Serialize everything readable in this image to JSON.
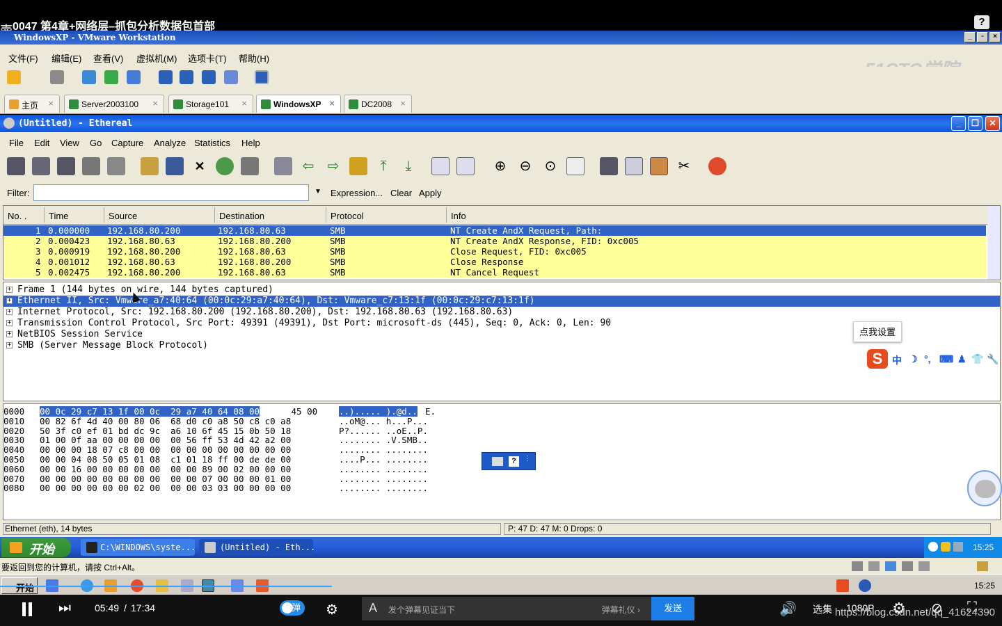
{
  "video": {
    "title": "0047 第4章+网络层–抓包分析数据包首部",
    "help_btn": "?",
    "corner_char": "壷",
    "time_current": "05:49",
    "time_sep": "/",
    "time_total": "17:34",
    "danmu_toggle": "弹",
    "danmu_placeholder": "发个弹幕见证当下",
    "danmu_gift": "弹幕礼仪 ›",
    "send": "发送",
    "select_episode": "选集",
    "quality": "1080P",
    "watermark": "https://blog.csdn.net/qq_41624390",
    "progress_fraction": 0.331
  },
  "vmware": {
    "title": "WindowsXP - VMware Workstation",
    "window_buttons": [
      "_",
      "▫",
      "×"
    ],
    "menu": [
      "文件(F)",
      "编辑(E)",
      "查看(V)",
      "虚拟机(M)",
      "选项卡(T)",
      "帮助(H)"
    ],
    "logo": "51CTO学院",
    "tabs": [
      {
        "label": "主页"
      },
      {
        "label": "Server2003100"
      },
      {
        "label": "Storage101"
      },
      {
        "label": "WindowsXP"
      },
      {
        "label": "DC2008"
      }
    ],
    "tab_close": "×",
    "hint": "要返回到您的计算机，请按 Ctrl+Alt。",
    "host_start": "开始",
    "host_time": "15:25"
  },
  "ethereal": {
    "title": "(Untitled) - Ethereal",
    "menu": [
      "File",
      "Edit",
      "View",
      "Go",
      "Capture",
      "Analyze",
      "Statistics",
      "Help"
    ],
    "filter_label": "Filter:",
    "filter_value": "",
    "filter_buttons": [
      "Expression...",
      "Clear",
      "Apply"
    ],
    "columns": [
      "No. .",
      "Time",
      "Source",
      "Destination",
      "Protocol",
      "Info"
    ],
    "packets": [
      {
        "no": "1",
        "time": "0.000000",
        "src": "192.168.80.200",
        "dst": "192.168.80.63",
        "proto": "SMB",
        "info": "NT Create AndX Request, Path:"
      },
      {
        "no": "2",
        "time": "0.000423",
        "src": "192.168.80.63",
        "dst": "192.168.80.200",
        "proto": "SMB",
        "info": "NT Create AndX Response, FID: 0xc005"
      },
      {
        "no": "3",
        "time": "0.000919",
        "src": "192.168.80.200",
        "dst": "192.168.80.63",
        "proto": "SMB",
        "info": "Close Request, FID: 0xc005"
      },
      {
        "no": "4",
        "time": "0.001012",
        "src": "192.168.80.63",
        "dst": "192.168.80.200",
        "proto": "SMB",
        "info": "Close Response"
      },
      {
        "no": "5",
        "time": "0.002475",
        "src": "192.168.80.200",
        "dst": "192.168.80.63",
        "proto": "SMB",
        "info": "NT Cancel Request"
      }
    ],
    "details": [
      "Frame 1 (144 bytes on wire, 144 bytes captured)",
      "Ethernet II, Src: Vmware_a7:40:64 (00:0c:29:a7:40:64), Dst: Vmware_c7:13:1f (00:0c:29:c7:13:1f)",
      "Internet Protocol, Src: 192.168.80.200 (192.168.80.200), Dst: 192.168.80.63 (192.168.80.63)",
      "Transmission Control Protocol, Src Port: 49391 (49391), Dst Port: microsoft-ds (445), Seq: 0, Ack: 0, Len: 90",
      "NetBIOS Session Service",
      "SMB (Server Message Block Protocol)"
    ],
    "expander": "+",
    "hex": [
      {
        "off": "0000",
        "hl": "00 0c 29 c7 13 1f 00 0c  29 a7 40 64 08 00",
        "rest": " 45 00",
        "ahl": "..)..... ).@d..",
        "arest": "E."
      },
      {
        "off": "0010",
        "hl": "",
        "rest": "00 82 6f 4d 40 00 80 06  68 d0 c0 a8 50 c8 c0 a8",
        "ahl": "",
        "arest": "..oM@... h...P..."
      },
      {
        "off": "0020",
        "hl": "",
        "rest": "50 3f c0 ef 01 bd dc 9c  a6 10 6f 45 15 0b 50 18",
        "ahl": "",
        "arest": "P?...... ..oE..P."
      },
      {
        "off": "0030",
        "hl": "",
        "rest": "01 00 0f aa 00 00 00 00  00 56 ff 53 4d 42 a2 00",
        "ahl": "",
        "arest": "........ .V.SMB.."
      },
      {
        "off": "0040",
        "hl": "",
        "rest": "00 00 00 18 07 c8 00 00  00 00 00 00 00 00 00 00",
        "ahl": "",
        "arest": "........ ........"
      },
      {
        "off": "0050",
        "hl": "",
        "rest": "00 00 04 08 50 05 01 08  c1 01 18 ff 00 de de 00",
        "ahl": "",
        "arest": "....P... ........"
      },
      {
        "off": "0060",
        "hl": "",
        "rest": "00 00 16 00 00 00 00 00  00 00 89 00 02 00 00 00",
        "ahl": "",
        "arest": "........ ........"
      },
      {
        "off": "0070",
        "hl": "",
        "rest": "00 00 00 00 00 00 00 00  00 00 07 00 00 00 01 00",
        "ahl": "",
        "arest": "........ ........"
      },
      {
        "off": "0080",
        "hl": "",
        "rest": "00 00 00 00 00 00 02 00  00 00 03 03 00 00 00 00",
        "ahl": "",
        "arest": "........ ........"
      }
    ],
    "status_left": "Ethernet (eth), 14 bytes",
    "status_right": "P: 47 D: 47 M: 0 Drops: 0"
  },
  "xp": {
    "start": "开始",
    "tasks": [
      "C:\\WINDOWS\\syste...",
      "(Untitled) - Eth..."
    ],
    "time": "15:25"
  },
  "overlay": {
    "tip": "点我设置",
    "ime_logo": "S",
    "ime_items": [
      "中",
      "☽",
      "°,",
      "⌨",
      "♟",
      "👕",
      "🔧"
    ],
    "mini_help": "?"
  }
}
